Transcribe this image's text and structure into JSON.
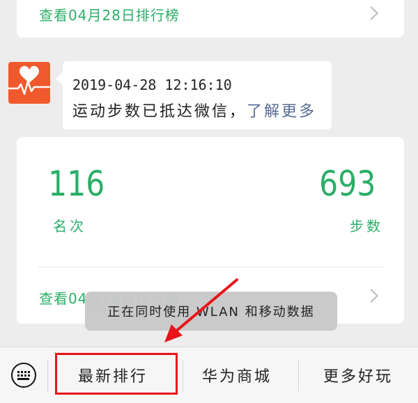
{
  "top_card": {
    "link_text": "查看04月28日排行榜"
  },
  "message": {
    "avatar_icon": "heart-pulse-icon",
    "timestamp": "2019-04-28 12:16:10",
    "text": "运动步数已抵达微信，",
    "link_text": "了解更多"
  },
  "stats": {
    "rank_value": "116",
    "rank_label": "名次",
    "steps_value": "693",
    "steps_label": "步数",
    "link_text": "查看04月28日排行榜"
  },
  "toast": {
    "text": "正在同时使用 WLAN 和移动数据"
  },
  "bottom_bar": {
    "keyboard_icon": "keyboard-icon",
    "items": [
      {
        "label": "最新排行"
      },
      {
        "label": "华为商城"
      },
      {
        "label": "更多好玩"
      }
    ]
  },
  "colors": {
    "accent_green": "#2aae67",
    "link_blue": "#576b95",
    "annotation_red": "#e8141a",
    "avatar_orange": "#f0592b"
  }
}
